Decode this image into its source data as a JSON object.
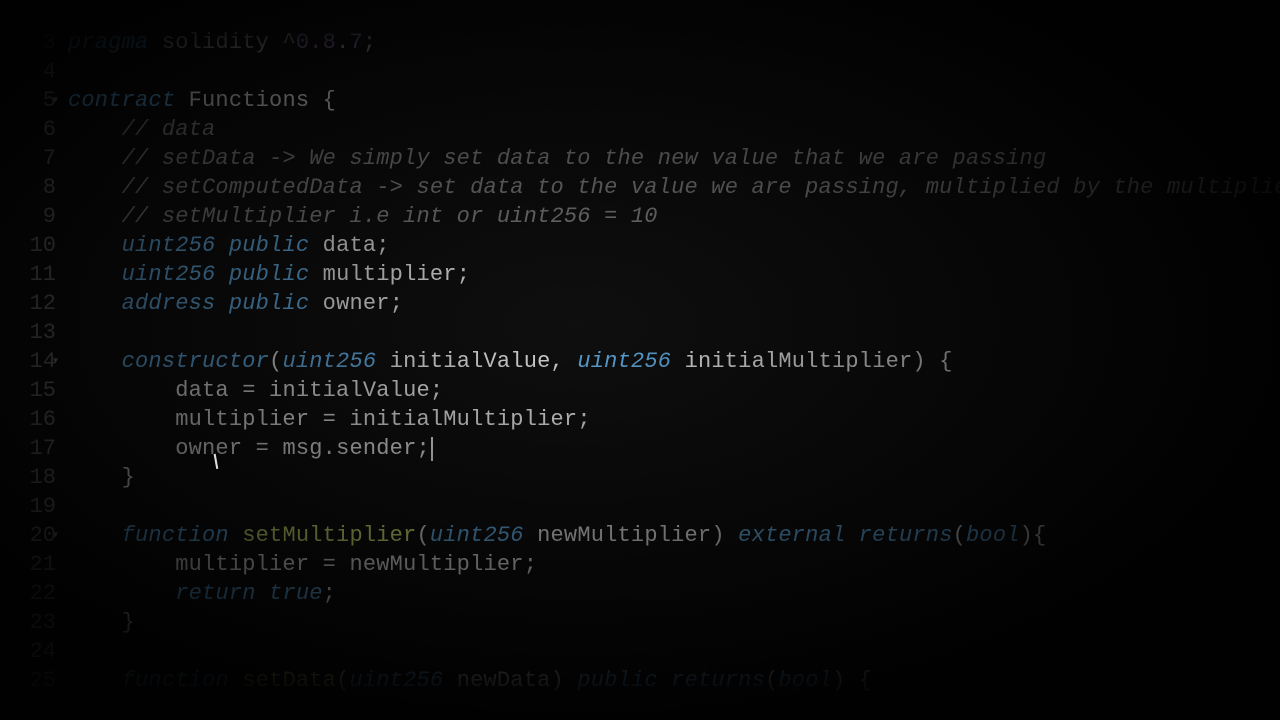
{
  "gutter": {
    "start": 3,
    "foldable": [
      5,
      14,
      20
    ]
  },
  "code": {
    "lines": [
      [
        {
          "t": "kw",
          "v": "pragma"
        },
        {
          "t": "op",
          "v": " "
        },
        {
          "t": "ident",
          "v": "solidity"
        },
        {
          "t": "op",
          "v": " ^"
        },
        {
          "t": "num",
          "v": "0.8"
        },
        {
          "t": "op",
          "v": "."
        },
        {
          "t": "num",
          "v": "7"
        },
        {
          "t": "punc",
          "v": ";"
        }
      ],
      [],
      [
        {
          "t": "kw",
          "v": "contract"
        },
        {
          "t": "op",
          "v": " "
        },
        {
          "t": "ident",
          "v": "Functions"
        },
        {
          "t": "op",
          "v": " "
        },
        {
          "t": "punc",
          "v": "{"
        }
      ],
      [
        {
          "t": "op",
          "v": "    "
        },
        {
          "t": "comment",
          "v": "// data"
        }
      ],
      [
        {
          "t": "op",
          "v": "    "
        },
        {
          "t": "comment",
          "v": "// setData -> We simply set data to the new value that we are passing"
        }
      ],
      [
        {
          "t": "op",
          "v": "    "
        },
        {
          "t": "comment",
          "v": "// setComputedData -> set data to the value we are passing, multiplied by the multiplie"
        }
      ],
      [
        {
          "t": "op",
          "v": "    "
        },
        {
          "t": "comment",
          "v": "// setMultiplier i.e int or uint256 = 10"
        }
      ],
      [
        {
          "t": "op",
          "v": "    "
        },
        {
          "t": "type",
          "v": "uint256"
        },
        {
          "t": "op",
          "v": " "
        },
        {
          "t": "mod",
          "v": "public"
        },
        {
          "t": "op",
          "v": " "
        },
        {
          "t": "ident",
          "v": "data"
        },
        {
          "t": "punc",
          "v": ";"
        }
      ],
      [
        {
          "t": "op",
          "v": "    "
        },
        {
          "t": "type",
          "v": "uint256"
        },
        {
          "t": "op",
          "v": " "
        },
        {
          "t": "mod",
          "v": "public"
        },
        {
          "t": "op",
          "v": " "
        },
        {
          "t": "ident",
          "v": "multiplier"
        },
        {
          "t": "punc",
          "v": ";"
        }
      ],
      [
        {
          "t": "op",
          "v": "    "
        },
        {
          "t": "type",
          "v": "address"
        },
        {
          "t": "op",
          "v": " "
        },
        {
          "t": "mod",
          "v": "public"
        },
        {
          "t": "op",
          "v": " "
        },
        {
          "t": "ident",
          "v": "owner"
        },
        {
          "t": "punc",
          "v": ";"
        }
      ],
      [],
      [
        {
          "t": "op",
          "v": "    "
        },
        {
          "t": "kw",
          "v": "constructor"
        },
        {
          "t": "punc",
          "v": "("
        },
        {
          "t": "type",
          "v": "uint256"
        },
        {
          "t": "op",
          "v": " "
        },
        {
          "t": "ident",
          "v": "initialValue"
        },
        {
          "t": "punc",
          "v": ","
        },
        {
          "t": "op",
          "v": " "
        },
        {
          "t": "type",
          "v": "uint256"
        },
        {
          "t": "op",
          "v": " "
        },
        {
          "t": "ident",
          "v": "initialMultiplier"
        },
        {
          "t": "punc",
          "v": ")"
        },
        {
          "t": "op",
          "v": " "
        },
        {
          "t": "punc",
          "v": "{"
        }
      ],
      [
        {
          "t": "op",
          "v": "        "
        },
        {
          "t": "ident",
          "v": "data"
        },
        {
          "t": "op",
          "v": " = "
        },
        {
          "t": "ident",
          "v": "initialValue"
        },
        {
          "t": "punc",
          "v": ";"
        }
      ],
      [
        {
          "t": "op",
          "v": "        "
        },
        {
          "t": "ident",
          "v": "multiplier"
        },
        {
          "t": "op",
          "v": " = "
        },
        {
          "t": "ident",
          "v": "initialMultiplier"
        },
        {
          "t": "punc",
          "v": ";"
        }
      ],
      [
        {
          "t": "op",
          "v": "        "
        },
        {
          "t": "ident",
          "v": "owner"
        },
        {
          "t": "op",
          "v": " = "
        },
        {
          "t": "ident",
          "v": "msg"
        },
        {
          "t": "op",
          "v": "."
        },
        {
          "t": "ident",
          "v": "sender"
        },
        {
          "t": "punc",
          "v": ";"
        },
        {
          "t": "cursor",
          "v": ""
        }
      ],
      [
        {
          "t": "op",
          "v": "    "
        },
        {
          "t": "punc",
          "v": "}"
        }
      ],
      [],
      [
        {
          "t": "op",
          "v": "    "
        },
        {
          "t": "kw",
          "v": "function"
        },
        {
          "t": "op",
          "v": " "
        },
        {
          "t": "fn",
          "v": "setMultiplier"
        },
        {
          "t": "punc",
          "v": "("
        },
        {
          "t": "type",
          "v": "uint256"
        },
        {
          "t": "op",
          "v": " "
        },
        {
          "t": "ident",
          "v": "newMultiplier"
        },
        {
          "t": "punc",
          "v": ")"
        },
        {
          "t": "op",
          "v": " "
        },
        {
          "t": "mod",
          "v": "external"
        },
        {
          "t": "op",
          "v": " "
        },
        {
          "t": "kw",
          "v": "returns"
        },
        {
          "t": "punc",
          "v": "("
        },
        {
          "t": "type",
          "v": "bool"
        },
        {
          "t": "punc",
          "v": ")"
        },
        {
          "t": "punc",
          "v": "{"
        }
      ],
      [
        {
          "t": "op",
          "v": "        "
        },
        {
          "t": "ident",
          "v": "multiplier"
        },
        {
          "t": "op",
          "v": " = "
        },
        {
          "t": "ident",
          "v": "newMultiplier"
        },
        {
          "t": "punc",
          "v": ";"
        }
      ],
      [
        {
          "t": "op",
          "v": "        "
        },
        {
          "t": "kw",
          "v": "return"
        },
        {
          "t": "op",
          "v": " "
        },
        {
          "t": "kw",
          "v": "true"
        },
        {
          "t": "punc",
          "v": ";"
        }
      ],
      [
        {
          "t": "op",
          "v": "    "
        },
        {
          "t": "punc",
          "v": "}"
        }
      ],
      [],
      [
        {
          "t": "op",
          "v": "    "
        },
        {
          "t": "kw",
          "v": "function"
        },
        {
          "t": "op",
          "v": " "
        },
        {
          "t": "fn",
          "v": "setData"
        },
        {
          "t": "punc",
          "v": "("
        },
        {
          "t": "type",
          "v": "uint256"
        },
        {
          "t": "op",
          "v": " "
        },
        {
          "t": "ident",
          "v": "newData"
        },
        {
          "t": "punc",
          "v": ")"
        },
        {
          "t": "op",
          "v": " "
        },
        {
          "t": "mod",
          "v": "public"
        },
        {
          "t": "op",
          "v": " "
        },
        {
          "t": "kw",
          "v": "returns"
        },
        {
          "t": "punc",
          "v": "("
        },
        {
          "t": "type",
          "v": "bool"
        },
        {
          "t": "punc",
          "v": ")"
        },
        {
          "t": "op",
          "v": " "
        },
        {
          "t": "punc",
          "v": "{"
        }
      ]
    ]
  }
}
